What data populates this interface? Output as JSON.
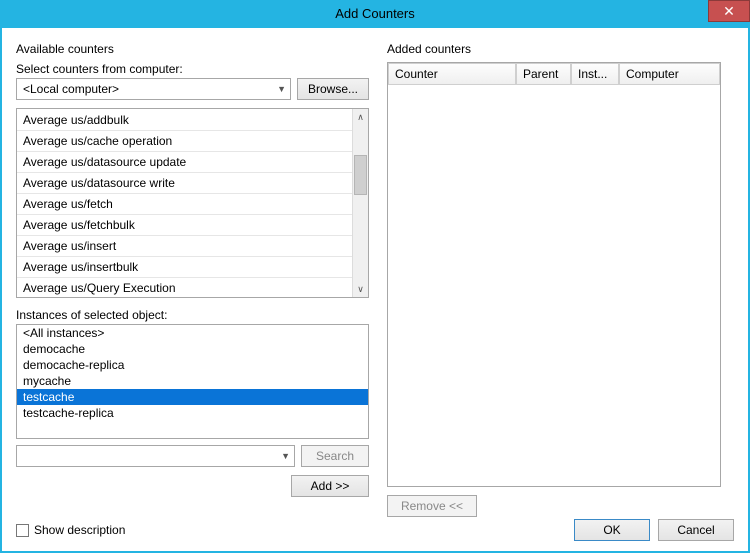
{
  "title": "Add Counters",
  "close_symbol": "✕",
  "left": {
    "group_label": "Available counters",
    "select_label": "Select counters from computer:",
    "computer_value": "<Local computer>",
    "browse_label": "Browse...",
    "counters": [
      "Average us/addbulk",
      "Average us/cache operation",
      "Average us/datasource update",
      "Average us/datasource write",
      "Average us/fetch",
      "Average us/fetchbulk",
      "Average us/insert",
      "Average us/insertbulk",
      "Average us/Query Execution"
    ],
    "instances_label": "Instances of selected object:",
    "instances": [
      {
        "label": "<All instances>",
        "selected": false
      },
      {
        "label": "democache",
        "selected": false
      },
      {
        "label": "democache-replica",
        "selected": false
      },
      {
        "label": "mycache",
        "selected": false
      },
      {
        "label": "testcache",
        "selected": true
      },
      {
        "label": "testcache-replica",
        "selected": false
      }
    ],
    "search_value": "",
    "search_label": "Search",
    "add_label": "Add >>"
  },
  "right": {
    "group_label": "Added counters",
    "columns": {
      "counter": "Counter",
      "parent": "Parent",
      "inst": "Inst...",
      "computer": "Computer"
    },
    "remove_label": "Remove <<"
  },
  "bottom": {
    "show_desc_label": "Show description",
    "ok_label": "OK",
    "cancel_label": "Cancel"
  }
}
